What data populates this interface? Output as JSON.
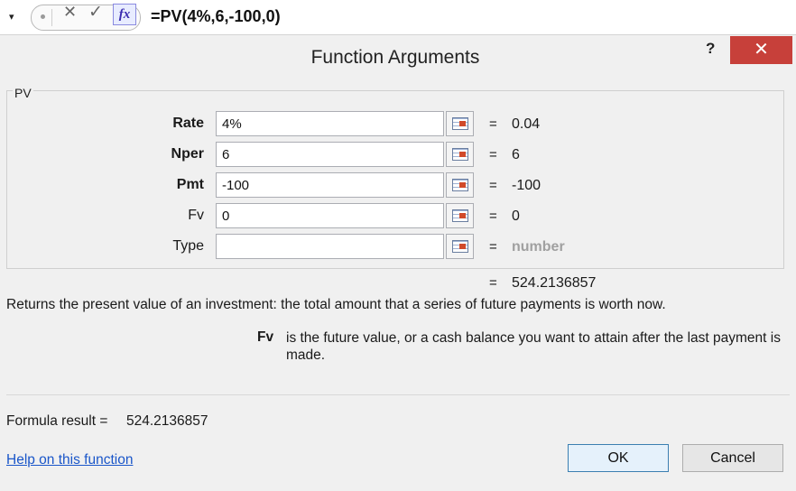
{
  "formula_bar": {
    "dropdown_glyph": "▾",
    "cancel_glyph": "✕",
    "enter_glyph": "✓",
    "fx_label": "fx",
    "formula": "=PV(4%,6,-100,0)"
  },
  "dialog": {
    "title": "Function Arguments",
    "help_glyph": "?",
    "close_glyph": "✕",
    "group_label": "PV",
    "args": [
      {
        "label": "Rate",
        "value": "4%",
        "result": "0.04",
        "required": true
      },
      {
        "label": "Nper",
        "value": "6",
        "result": "6",
        "required": true
      },
      {
        "label": "Pmt",
        "value": "-100",
        "result": "-100",
        "required": true
      },
      {
        "label": "Fv",
        "value": "0",
        "result": "0",
        "required": false
      },
      {
        "label": "Type",
        "value": "",
        "result": "number",
        "required": false
      }
    ],
    "equals": "=",
    "function_result": "524.2136857",
    "description": "Returns the present value of an investment: the total amount that a series of future payments is worth now.",
    "current_arg_name": "Fv",
    "current_arg_description": "is the future value, or a cash balance you want to attain after the last payment is made.",
    "formula_result_label": "Formula result =",
    "formula_result_value": "524.2136857",
    "help_link": "Help on this function",
    "ok_label": "OK",
    "cancel_label": "Cancel"
  },
  "colors": {
    "close_button": "#c7403a",
    "link": "#1a56c9",
    "ok_border": "#3c7fb1"
  }
}
